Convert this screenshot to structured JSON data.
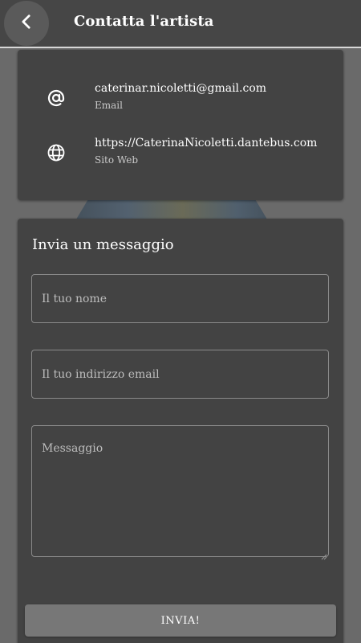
{
  "header": {
    "title": "Contatta l'artista",
    "back_icon": "chevron-left-icon"
  },
  "contacts": [
    {
      "icon": "at-sign-icon",
      "value": "caterinar.nicoletti@gmail.com",
      "label": "Email"
    },
    {
      "icon": "globe-icon",
      "value": "https://CaterinaNicoletti.dantebus.com",
      "label": "Sito Web"
    }
  ],
  "message_form": {
    "title": "Invia un messaggio",
    "name_placeholder": "Il tuo nome",
    "email_placeholder": "Il tuo indirizzo email",
    "message_placeholder": "Messaggio",
    "submit_label": "INVIA!"
  },
  "colors": {
    "background": "#6a6a6a",
    "card": "#434343",
    "topbar": "#464646",
    "button": "#777777",
    "text": "#ffffff",
    "secondary_text": "#c8c8c8"
  }
}
